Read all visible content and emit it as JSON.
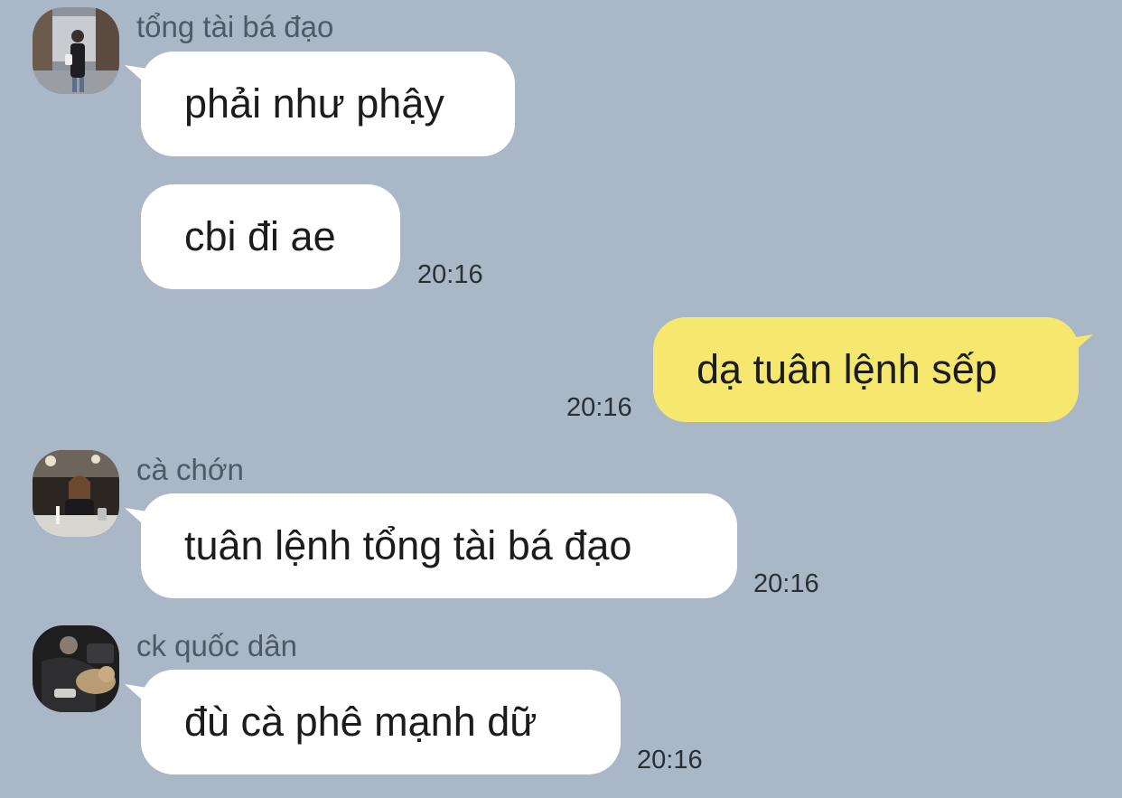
{
  "colors": {
    "background": "#a9b7c7",
    "incoming_bubble": "#ffffff",
    "outgoing_bubble": "#f6e86f",
    "sender_name": "#4f5966",
    "timestamp": "#2a2f36"
  },
  "messages": [
    {
      "sender": "tổng tài bá đạo",
      "avatar": "avatar-photo-street",
      "bubbles": [
        {
          "text": "phải như phậy"
        },
        {
          "text": "cbi đi ae",
          "time": "20:16"
        }
      ]
    },
    {
      "sender": "",
      "outgoing": true,
      "bubbles": [
        {
          "text": "dạ tuân lệnh sếp",
          "time": "20:16"
        }
      ]
    },
    {
      "sender": "cà chớn",
      "avatar": "avatar-photo-restaurant",
      "bubbles": [
        {
          "text": "tuân lệnh tổng tài bá đạo",
          "time": "20:16"
        }
      ]
    },
    {
      "sender": "ck quốc dân",
      "avatar": "avatar-photo-dog",
      "bubbles": [
        {
          "text": "đù cà phê mạnh dữ",
          "time": "20:16"
        }
      ]
    }
  ]
}
